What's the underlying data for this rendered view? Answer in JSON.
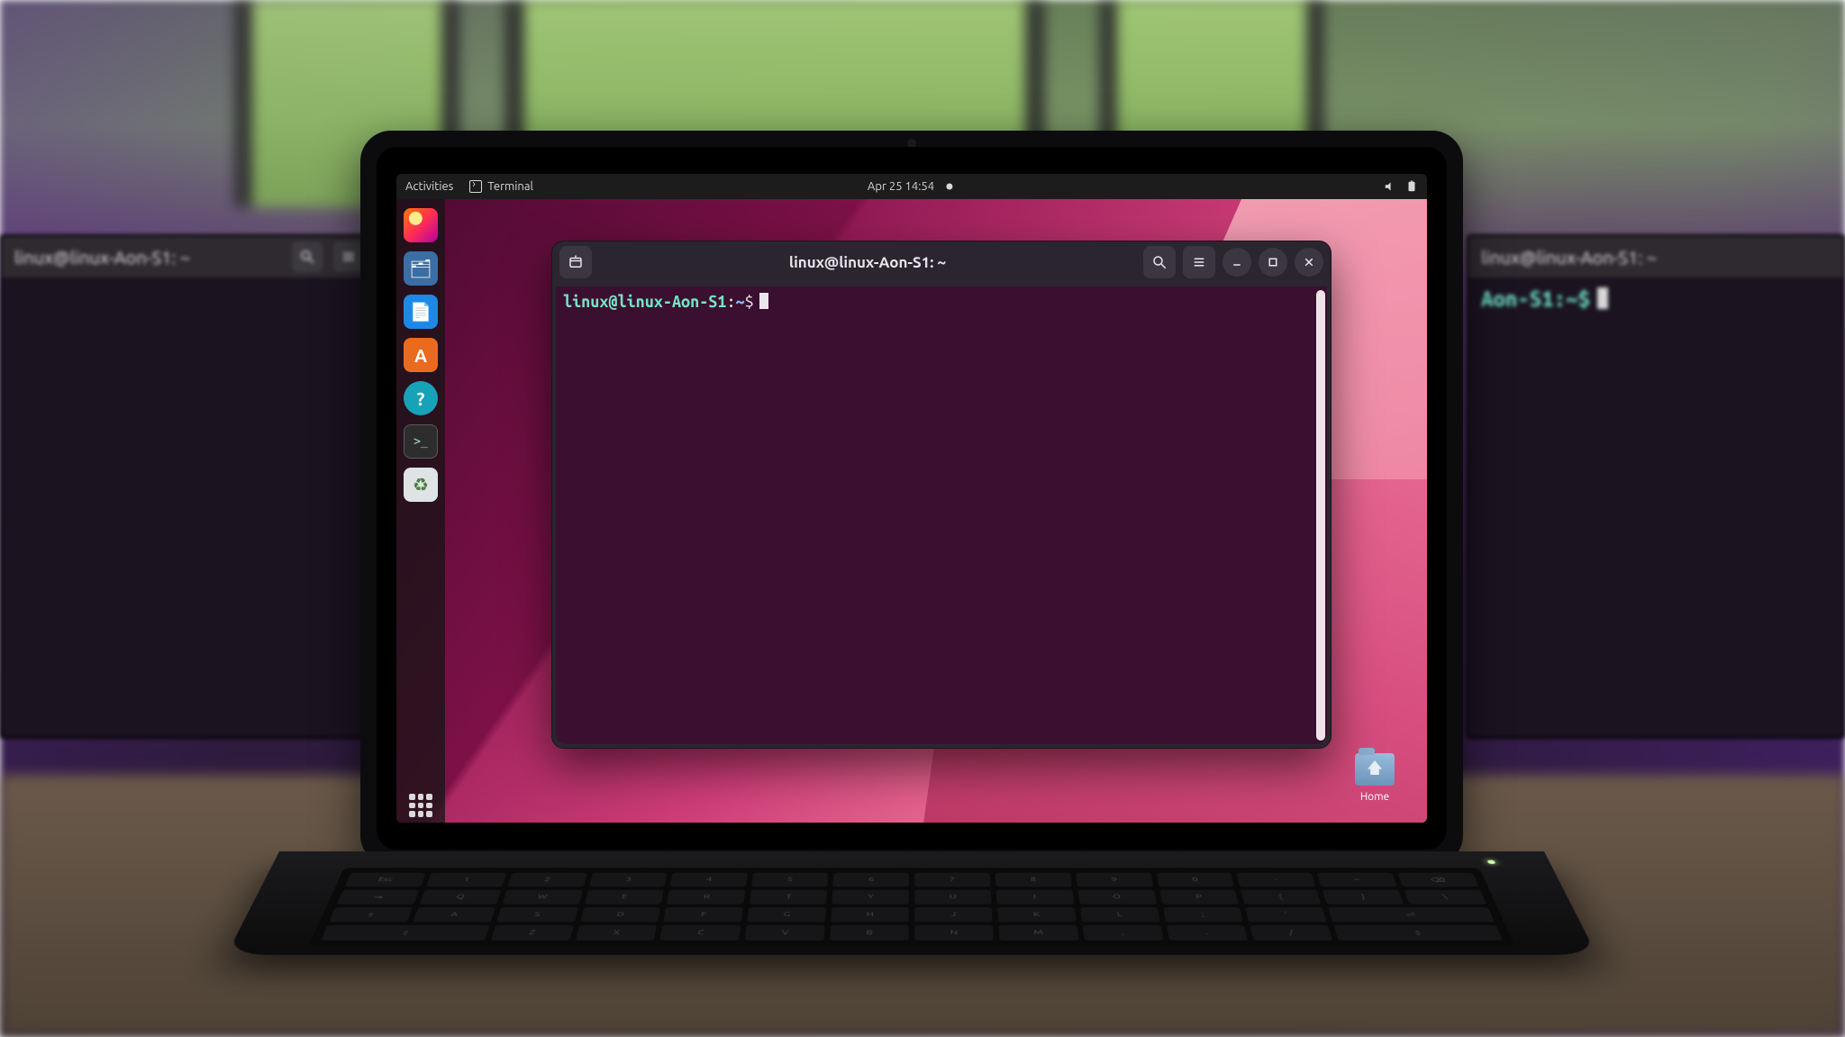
{
  "topbar": {
    "activities": "Activities",
    "app_label": "Terminal",
    "datetime": "Apr 25  14:54"
  },
  "dock": {
    "items": [
      {
        "name": "firefox",
        "glyph": ""
      },
      {
        "name": "files",
        "glyph": "🗂"
      },
      {
        "name": "writer",
        "glyph": "📄"
      },
      {
        "name": "software",
        "glyph": "A"
      },
      {
        "name": "help",
        "glyph": "?"
      },
      {
        "name": "terminal",
        "glyph": ">_"
      },
      {
        "name": "trash",
        "glyph": "♻"
      }
    ],
    "apps_label": "Show Applications"
  },
  "desktop": {
    "home_label": "Home"
  },
  "terminal": {
    "title": "linux@linux-Aon-S1: ~",
    "prompt_userhost": "linux@linux-Aon-S1",
    "prompt_sep": ":",
    "prompt_path": "~",
    "prompt_symbol": "$"
  },
  "side_monitors": {
    "left_title": "linux@linux-Aon-S1: ~",
    "right_title": "linux@linux-Aon-S1: ~",
    "right_prompt": "Aon-S1:~$"
  }
}
